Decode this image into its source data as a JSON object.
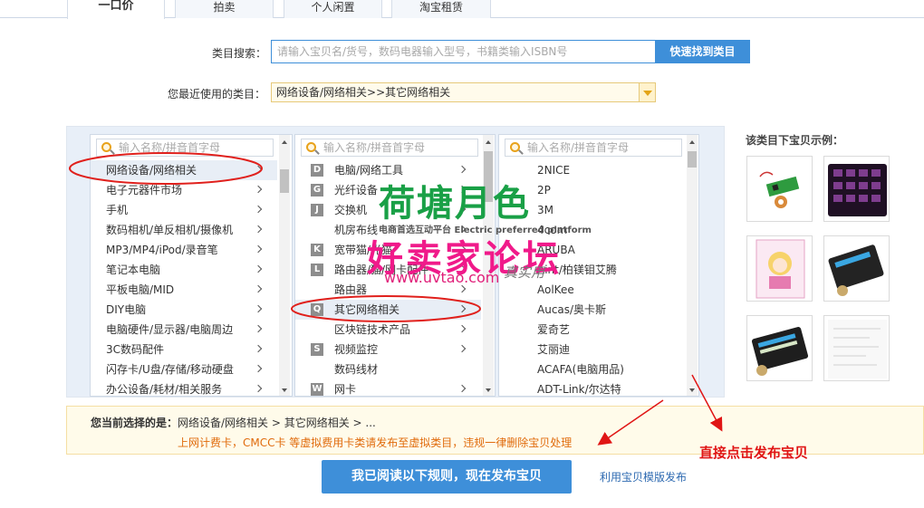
{
  "tabs": [
    {
      "label": "一口价",
      "active": true
    },
    {
      "label": "拍卖"
    },
    {
      "label": "个人闲置"
    },
    {
      "label": "淘宝租赁"
    }
  ],
  "search": {
    "label": "类目搜索：",
    "placeholder": "请输入宝贝名/货号，数码电器输入型号，书籍类输入ISBN号",
    "button": "快速找到类目"
  },
  "recent": {
    "label": "您最近使用的类目：",
    "value": "网络设备/网络相关>>其它网络相关"
  },
  "columns": [
    {
      "search_placeholder": "输入名称/拼音首字母",
      "items": [
        {
          "label": "网络设备/网络相关",
          "selected": true,
          "circled": true
        },
        {
          "label": "电子元器件市场"
        },
        {
          "label": "手机"
        },
        {
          "label": "数码相机/单反相机/摄像机"
        },
        {
          "label": "MP3/MP4/iPod/录音笔"
        },
        {
          "label": "笔记本电脑"
        },
        {
          "label": "平板电脑/MID"
        },
        {
          "label": "DIY电脑"
        },
        {
          "label": "电脑硬件/显示器/电脑周边"
        },
        {
          "label": "3C数码配件"
        },
        {
          "label": "闪存卡/U盘/存储/移动硬盘"
        },
        {
          "label": "办公设备/耗材/相关服务"
        }
      ]
    },
    {
      "search_placeholder": "输入名称/拼音首字母",
      "items": [
        {
          "letter": "D",
          "label": "电脑/网络工具",
          "arrow": true
        },
        {
          "letter": "G",
          "label": "光纤设备",
          "arrow": true
        },
        {
          "letter": "J",
          "label": "交换机",
          "arrow": true
        },
        {
          "letter": "",
          "label": "机房布线",
          "arrow": true
        },
        {
          "letter": "K",
          "label": "宽带猫/光猫",
          "arrow": true
        },
        {
          "letter": "L",
          "label": "路由器/猫/网卡配件",
          "arrow": true
        },
        {
          "letter": "",
          "label": "路由器",
          "arrow": true
        },
        {
          "letter": "Q",
          "label": "其它网络相关",
          "arrow": true,
          "selected": true,
          "circled": true
        },
        {
          "letter": "",
          "label": "区块链技术产品",
          "arrow": true
        },
        {
          "letter": "S",
          "label": "视频监控",
          "arrow": true
        },
        {
          "letter": "",
          "label": "数码线材",
          "arrow": false
        },
        {
          "letter": "W",
          "label": "网卡",
          "arrow": true
        }
      ]
    },
    {
      "search_placeholder": "输入名称/拼音首字母",
      "items": [
        {
          "label": "2NICE"
        },
        {
          "label": "2P"
        },
        {
          "label": "3M"
        },
        {
          "label": "4com"
        },
        {
          "label": "ARUBA"
        },
        {
          "label": "Aint/柏镁钼艾腾"
        },
        {
          "label": "AolKee"
        },
        {
          "label": "Aucas/奥卡斯"
        },
        {
          "label": "爱奇艺"
        },
        {
          "label": "艾丽迪"
        },
        {
          "label": "ACAFA(电脑用品)"
        },
        {
          "label": "ADT-Link/尔达特"
        }
      ]
    }
  ],
  "examples": {
    "title": "该类目下宝贝示例："
  },
  "current": {
    "label": "您当前选择的是：",
    "path": "网络设备/网络相关 > 其它网络相关 > ...",
    "warning": "上网计费卡，CMCC卡 等虚拟费用卡类请发布至虚拟类目，违规一律删除宝贝处理"
  },
  "publish_button": "我已阅读以下规则，现在发布宝贝",
  "template_link": "利用宝贝模版发布",
  "annotation": "直接点击发布宝贝",
  "watermark": {
    "logo": "荷塘月色",
    "slogan": "电商首选互动平台",
    "slogan_en": "Electric preferred platform",
    "big": "好卖家论坛",
    "url": "www.uvtao.com",
    "stamp": "真实用"
  },
  "colors": {
    "accent": "#3e8fd9",
    "warning": "#e06b0c",
    "annotation": "#e01515"
  }
}
